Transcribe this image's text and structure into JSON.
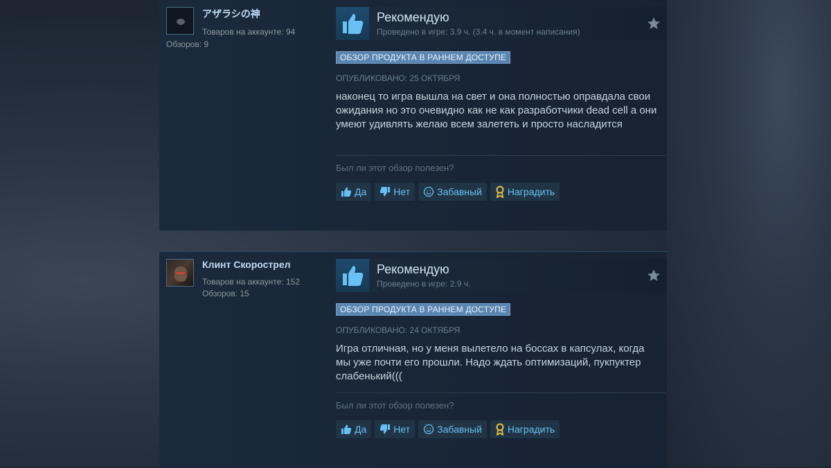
{
  "reviews": [
    {
      "username": "アザラシの神",
      "products_owned": "Товаров на аккаунте: 94",
      "review_count": "Обзоров: 9",
      "verdict": "Рекомендую",
      "hours": "Проведено в игре: 3.9 ч. (3.4 ч. в момент написания)",
      "badge": "ОБЗОР ПРОДУКТА В РАННЕМ ДОСТУПЕ",
      "posted": "ОПУБЛИКОВАНО: 25 ОКТЯБРЯ",
      "text": "наконец то игра вышла на свет и она полностью оправдала свои ожидания но это очевидно как не как разработчики dead cell а они умеют удивлять желаю всем залететь и просто насладится",
      "helpful_question": "Был ли этот обзор полезен?",
      "buttons": {
        "yes": "Да",
        "no": "Нет",
        "funny": "Забавный",
        "award": "Наградить"
      }
    },
    {
      "username": "Клинт Скорострел",
      "products_owned": "Товаров на аккаунте: 152",
      "review_count": "Обзоров: 15",
      "verdict": "Рекомендую",
      "hours": "Проведено в игре: 2.9 ч.",
      "badge": "ОБЗОР ПРОДУКТА В РАННЕМ ДОСТУПЕ",
      "posted": "ОПУБЛИКОВАНО: 24 ОКТЯБРЯ",
      "text": "Игра отличная, но у меня вылетело на боссах в капсулах, когда мы уже почти его прошли. Надо ждать оптимизаций, пукпуктер слабенький(((",
      "helpful_question": "Был ли этот обзор полезен?",
      "buttons": {
        "yes": "Да",
        "no": "Нет",
        "funny": "Забавный",
        "award": "Наградить"
      }
    }
  ],
  "icons": {
    "thumb": "thumbs-up-icon",
    "star": "star-icon",
    "vote_up": "thumbs-up-small-icon",
    "vote_down": "thumbs-down-small-icon",
    "funny": "smiley-icon",
    "award": "award-icon"
  },
  "colors": {
    "link_blue": "#66c0f4",
    "badge_bg": "#5a85b0",
    "username": "#c1dbf4"
  }
}
